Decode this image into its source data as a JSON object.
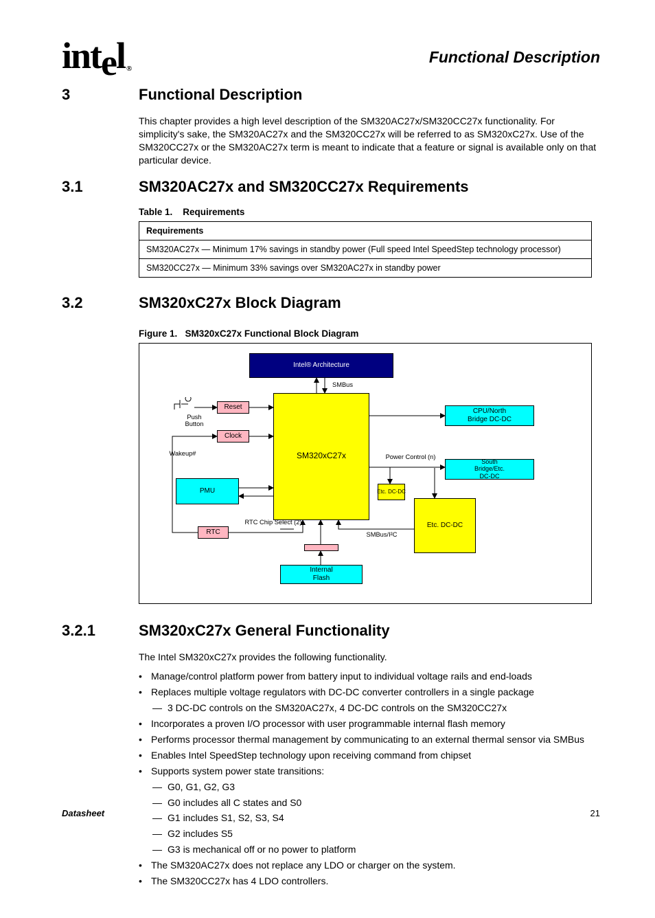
{
  "logo_text": "intel",
  "logo_reg": "®",
  "chapter_title": "Functional Description",
  "section3": {
    "num": "3",
    "title": "Functional Description"
  },
  "intro": "This chapter provides a high level description of the SM320AC27x/SM320CC27x functionality. For simplicity's sake, the SM320AC27x and the SM320CC27x will be referred to as SM320xC27x. Use of the SM320CC27x or the SM320AC27x term is meant to indicate that a feature or signal is available only on that particular device.",
  "section31": {
    "num": "3.1",
    "title": "SM320AC27x and SM320CC27x Requirements"
  },
  "requirements": {
    "caption_num": "Table 1.",
    "caption": "Requirements",
    "header": "Requirements",
    "row1": "SM320AC27x — Minimum 17% savings in standby power (Full speed Intel SpeedStep technology processor)",
    "row2": "SM320CC27x — Minimum 33% savings over SM320AC27x in standby power"
  },
  "section32": {
    "num": "3.2",
    "title": "SM320xC27x Block Diagram"
  },
  "figure": {
    "caption_num": "Figure 1.",
    "caption": "SM320xC27x Functional Block Diagram",
    "blocks": {
      "intel": "Intel® Architecture",
      "sm320": "SM320xC27x",
      "reset": "Reset",
      "clock": "Clock",
      "rtc": "RTC",
      "pmu": "PMU",
      "flash": "Internal\nFlash",
      "dc_cpu": "CPU/North\nBridge DC-DC",
      "dc_se": "South\nBridge/Etc.\nDC-DC",
      "dc_etc1": "Etc. DC-DC",
      "dc_etc2": "Etc. DC-DC"
    },
    "labels": {
      "push": "Push Button",
      "wakeup": "Wakeup#",
      "smbus": "SMBus",
      "rtc_cs": "RTC Chip Select (2)",
      "pwr_ctrl": "Power Control (n)",
      "i2c": "SMBus/I²C"
    }
  },
  "section321": {
    "num": "3.2.1",
    "title": "SM320xC27x General Functionality"
  },
  "gen_intro": "The Intel SM320xC27x provides the following functionality.",
  "bullets": {
    "b1": "Manage/control platform power from battery input to individual voltage rails and end-loads",
    "b2": "Replaces multiple voltage regulators with DC-DC converter controllers in a single package",
    "b2a": "3 DC-DC controls on the SM320AC27x, 4 DC-DC controls on the SM320CC27x",
    "b3": "Incorporates a proven I/O processor with user programmable internal flash memory",
    "b4": "Performs processor thermal management by communicating to an external thermal sensor via SMBus",
    "b5": "Enables Intel SpeedStep technology upon receiving command from chipset",
    "b6": "Supports system power state transitions:",
    "b6a": "G0, G1, G2, G3",
    "b6b": "G0 includes all C states and S0",
    "b6c": "G1 includes S1, S2, S3, S4",
    "b6d": "G2 includes S5",
    "b6e": "G3 is mechanical off or no power to platform",
    "b7": "The SM320AC27x does not replace any LDO or charger on the system.",
    "b8": "The SM320CC27x has 4 LDO controllers."
  },
  "footer": {
    "left": "Datasheet",
    "right": "21"
  },
  "chart_data": {
    "type": "diagram",
    "nodes": [
      {
        "id": "intel_arch",
        "label": "Intel® Architecture",
        "color": "#000080"
      },
      {
        "id": "sm320",
        "label": "SM320xC27x",
        "color": "#ffff00"
      },
      {
        "id": "reset",
        "label": "Reset",
        "color": "#ffb6c1"
      },
      {
        "id": "clock",
        "label": "Clock",
        "color": "#ffb6c1"
      },
      {
        "id": "rtc",
        "label": "RTC",
        "color": "#ffb6c1"
      },
      {
        "id": "pmu",
        "label": "PMU",
        "color": "#00ffff"
      },
      {
        "id": "flash",
        "label": "Internal Flash",
        "color": "#ffff00"
      },
      {
        "id": "dc_cpu",
        "label": "CPU/North Bridge DC-DC",
        "color": "#00ffff"
      },
      {
        "id": "dc_se",
        "label": "South Bridge/Etc. DC-DC",
        "color": "#00ffff"
      },
      {
        "id": "dc_etc1",
        "label": "Etc. DC-DC",
        "color": "#ffff00"
      },
      {
        "id": "dc_etc2",
        "label": "Etc. DC-DC",
        "color": "#ffff00"
      },
      {
        "id": "rtc_box",
        "label": "",
        "color": "#ffb6c1"
      }
    ],
    "edges": [
      {
        "from": "push_button",
        "to": "reset",
        "label": "Push Button"
      },
      {
        "from": "reset",
        "to": "sm320"
      },
      {
        "from": "clock",
        "to": "sm320"
      },
      {
        "from": "sm320",
        "to": "intel_arch",
        "bidir": true,
        "label": "SMBus"
      },
      {
        "from": "sm320",
        "to": "pmu",
        "bidir": true
      },
      {
        "from": "flash",
        "to": "sm320"
      },
      {
        "from": "dc_etc2",
        "to": "sm320",
        "label": "SMBus/I²C"
      },
      {
        "from": "rtc",
        "to": "clock",
        "label": "Wakeup#"
      },
      {
        "from": "rtc",
        "to": "sm320",
        "label": "RTC Chip Select (2)"
      },
      {
        "from": "sm320",
        "to": "dc_cpu"
      },
      {
        "from": "sm320",
        "to": "dc_se",
        "label": "Power Control (n)"
      },
      {
        "from": "sm320",
        "to": "dc_etc1"
      },
      {
        "from": "sm320",
        "to": "dc_etc2"
      }
    ]
  }
}
